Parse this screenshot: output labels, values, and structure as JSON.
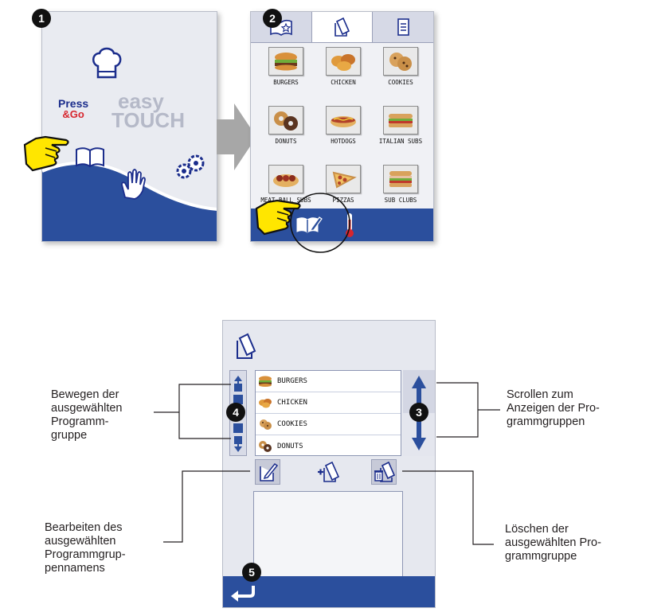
{
  "steps": {
    "s1": "1",
    "s2": "2",
    "s3": "3",
    "s4": "4",
    "s5": "5"
  },
  "screen1": {
    "press_line1": "Press",
    "press_line2": "&Go",
    "easy_line1": "easy",
    "easy_line2": "TOUCH",
    "icons": [
      "chef-hat-icon",
      "book-icon",
      "hand-icon",
      "gears-icon",
      "pointing-hand-icon"
    ]
  },
  "screen2": {
    "tabs": [
      "favorites-book-icon",
      "program-group-icon",
      "program-list-icon"
    ],
    "tiles": [
      {
        "label": "BURGERS"
      },
      {
        "label": "CHICKEN"
      },
      {
        "label": "COOKIES"
      },
      {
        "label": "DONUTS"
      },
      {
        "label": "HOTDOGS"
      },
      {
        "label": "ITALIAN SUBS"
      },
      {
        "label": "MEAT BALL SUBS"
      },
      {
        "label": "PIZZAS"
      },
      {
        "label": "SUB CLUBS"
      }
    ],
    "bottom_icons": [
      "edit-book-icon",
      "thermometer-icon"
    ]
  },
  "screen3": {
    "header_icon": "program-group-icon",
    "list": [
      "BURGERS",
      "CHICKEN",
      "COOKIES",
      "DONUTS"
    ],
    "tools": [
      "edit-name-icon",
      "add-group-icon",
      "delete-group-icon"
    ],
    "back_icon": "back-arrow-icon"
  },
  "annotations": {
    "move": [
      "Bewegen der",
      "ausgewählten",
      "Programm-",
      "gruppe"
    ],
    "scroll": [
      "Scrollen zum",
      "Anzeigen der Pro-",
      "grammgruppen"
    ],
    "edit": [
      "Bearbeiten des",
      "ausgewählten",
      "Programmgrup-",
      "pennamens"
    ],
    "delete": [
      "Löschen der",
      "ausgewählten Pro-",
      "grammgruppe"
    ]
  },
  "colors": {
    "primary_blue": "#2b4f9d",
    "icon_blue": "#1b2d8c",
    "accent_red": "#d7262e",
    "pointer_yellow": "#ffe600"
  }
}
